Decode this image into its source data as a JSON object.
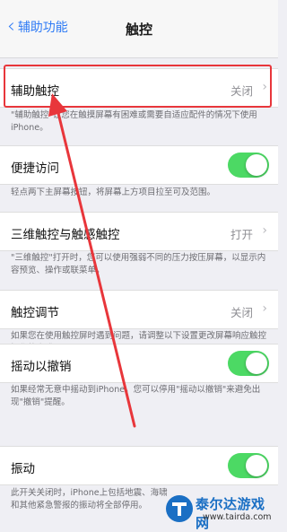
{
  "nav": {
    "back_label": "辅助功能",
    "title": "触控"
  },
  "rows": [
    {
      "label": "辅助触控",
      "value": "关闭"
    },
    {
      "label": "便捷访问",
      "toggle": "on"
    },
    {
      "label": "三维触控与触感触控",
      "value": "打开"
    },
    {
      "label": "触控调节",
      "value": "关闭"
    },
    {
      "label": "摇动以撤销",
      "toggle": "on"
    },
    {
      "label": "振动",
      "toggle": "on"
    }
  ],
  "notes": [
    "\"辅助触控\"让您在触摸屏幕有困难或需要自适应配件的情况下使用iPhone。",
    "轻点两下主屏幕按钮，将屏幕上方项目拉至可及范围。",
    "\"三维触控\"打开时，您可以使用强弱不同的压力按压屏幕，以显示内容预览、操作或联菜单。",
    "如果您在使用触控屏时遇到问题，请调整以下设置更改屏幕响应触控操作的方式。",
    "如果经常无意中摇动到iPhone，您可以停用\"摇动以撤销\"来避免出现\"撤销\"提醒。",
    "此开关关闭时，iPhone上包括地震、海啸和其他紧急警报的振动将全部停用。"
  ],
  "watermark": {
    "brand": "泰尔达游戏网",
    "url": "www.tairda.com"
  },
  "colors": {
    "accent": "#2f7bf5",
    "toggle_on": "#4cd964",
    "highlight": "#e8363b"
  }
}
